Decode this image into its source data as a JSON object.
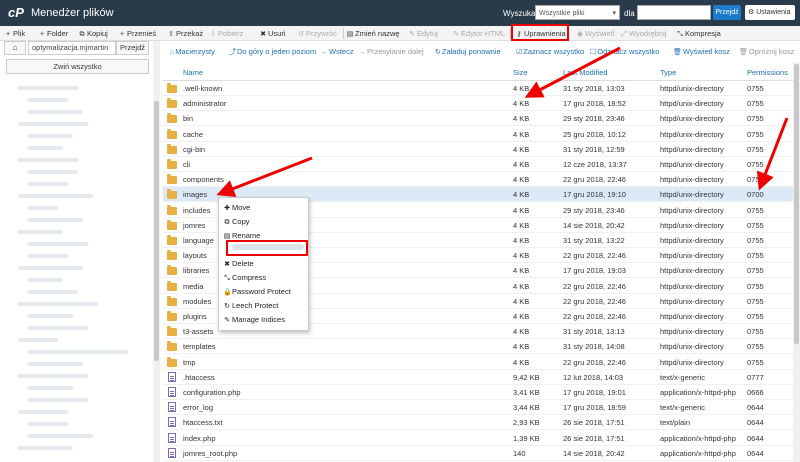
{
  "header": {
    "logo": "cP",
    "title": "Menedżer plików",
    "search_label": "Wyszukaj",
    "search_scope": "Wszystkie pliki",
    "in_label": "dla",
    "search_value": "",
    "go_label": "Przejdź",
    "settings_label": "Ustawienia"
  },
  "toolbar": {
    "file": "Plik",
    "folder": "Folder",
    "copy": "Kopiuj",
    "move": "Przenieś",
    "upload": "Przekaż",
    "download": "Pobierz",
    "delete": "Usuń",
    "restore": "Przywróć",
    "rename": "Zmień nazwę",
    "edit": "Edytuj",
    "html_editor": "Edytor HTML",
    "permissions": "Uprawnienia",
    "view": "Wyświetl",
    "extract": "Wyodrębnij",
    "compress": "Kompresja"
  },
  "left": {
    "path": "optymalizacja.mjmartin",
    "path_go": "Przejdź",
    "collapse_all": "Zwiń wszystko"
  },
  "actions": {
    "home": "Macierzysty",
    "up": "Do góry o jeden poziom",
    "back": "Wstecz",
    "forward": "Przesyłanie dalej",
    "reload": "Załaduj ponownie",
    "select_all": "Zaznacz wszystko",
    "unselect_all": "Odznacz wszystko",
    "view_trash": "Wyświetl kosz",
    "empty_trash": "Opróżnij kosz"
  },
  "table": {
    "columns": {
      "name": "Name",
      "size": "Size",
      "modified": "Last Modified",
      "type": "Type",
      "perms": "Permissions"
    },
    "rows": [
      {
        "kind": "folder",
        "name": ".well-known",
        "size": "4 KB",
        "modified": "31 sty 2018, 13:03",
        "type": "httpd/unix-directory",
        "perms": "0755"
      },
      {
        "kind": "folder",
        "name": "administrator",
        "size": "4 KB",
        "modified": "17 gru 2018, 18:52",
        "type": "httpd/unix-directory",
        "perms": "0755"
      },
      {
        "kind": "folder",
        "name": "bin",
        "size": "4 KB",
        "modified": "29 sty 2018, 23:46",
        "type": "httpd/unix-directory",
        "perms": "0755"
      },
      {
        "kind": "folder",
        "name": "cache",
        "size": "4 KB",
        "modified": "25 gru 2018, 10:12",
        "type": "httpd/unix-directory",
        "perms": "0755"
      },
      {
        "kind": "folder",
        "name": "cgi-bin",
        "size": "4 KB",
        "modified": "31 sty 2018, 12:59",
        "type": "httpd/unix-directory",
        "perms": "0755"
      },
      {
        "kind": "folder",
        "name": "cli",
        "size": "4 KB",
        "modified": "12 cze 2018, 13:37",
        "type": "httpd/unix-directory",
        "perms": "0755"
      },
      {
        "kind": "folder",
        "name": "components",
        "size": "4 KB",
        "modified": "22 gru 2018, 22:46",
        "type": "httpd/unix-directory",
        "perms": "0755"
      },
      {
        "kind": "folder",
        "name": "images",
        "size": "4 KB",
        "modified": "17 gru 2018, 19:10",
        "type": "httpd/unix-directory",
        "perms": "0700",
        "selected": true
      },
      {
        "kind": "folder",
        "name": "includes",
        "size": "4 KB",
        "modified": "29 sty 2018, 23:46",
        "type": "httpd/unix-directory",
        "perms": "0755"
      },
      {
        "kind": "folder",
        "name": "jomres",
        "size": "4 KB",
        "modified": "14 sie 2018, 20:42",
        "type": "httpd/unix-directory",
        "perms": "0755"
      },
      {
        "kind": "folder",
        "name": "language",
        "size": "4 KB",
        "modified": "31 sty 2018, 13:22",
        "type": "httpd/unix-directory",
        "perms": "0755"
      },
      {
        "kind": "folder",
        "name": "layouts",
        "size": "4 KB",
        "modified": "22 gru 2018, 22:46",
        "type": "httpd/unix-directory",
        "perms": "0755"
      },
      {
        "kind": "folder",
        "name": "libraries",
        "size": "4 KB",
        "modified": "17 gru 2018, 19:03",
        "type": "httpd/unix-directory",
        "perms": "0755"
      },
      {
        "kind": "folder",
        "name": "media",
        "size": "4 KB",
        "modified": "22 gru 2018, 22:46",
        "type": "httpd/unix-directory",
        "perms": "0755"
      },
      {
        "kind": "folder",
        "name": "modules",
        "size": "4 KB",
        "modified": "22 gru 2018, 22:46",
        "type": "httpd/unix-directory",
        "perms": "0755"
      },
      {
        "kind": "folder",
        "name": "plugins",
        "size": "4 KB",
        "modified": "22 gru 2018, 22:46",
        "type": "httpd/unix-directory",
        "perms": "0755"
      },
      {
        "kind": "folder",
        "name": "t3-assets",
        "size": "4 KB",
        "modified": "31 sty 2018, 13:13",
        "type": "httpd/unix-directory",
        "perms": "0755"
      },
      {
        "kind": "folder",
        "name": "templates",
        "size": "4 KB",
        "modified": "31 sty 2018, 14:08",
        "type": "httpd/unix-directory",
        "perms": "0755"
      },
      {
        "kind": "folder",
        "name": "tmp",
        "size": "4 KB",
        "modified": "22 gru 2018, 22:46",
        "type": "httpd/unix-directory",
        "perms": "0755"
      },
      {
        "kind": "file",
        "name": ".htaccess",
        "size": "9,42 KB",
        "modified": "12 lut 2018, 14:03",
        "type": "text/x-generic",
        "perms": "0777"
      },
      {
        "kind": "file",
        "name": "configuration.php",
        "size": "3,41 KB",
        "modified": "17 gru 2018, 19:01",
        "type": "application/x-httpd-php",
        "perms": "0666"
      },
      {
        "kind": "file",
        "name": "error_log",
        "size": "3,44 KB",
        "modified": "17 gru 2018, 18:59",
        "type": "text/x-generic",
        "perms": "0644"
      },
      {
        "kind": "file",
        "name": "htaccess.txt",
        "size": "2,93 KB",
        "modified": "26 sie 2018, 17:51",
        "type": "text/plain",
        "perms": "0644"
      },
      {
        "kind": "file",
        "name": "index.php",
        "size": "1,39 KB",
        "modified": "26 sie 2018, 17:51",
        "type": "application/x-httpd-php",
        "perms": "0644"
      },
      {
        "kind": "file",
        "name": "jomres_root.php",
        "size": "140",
        "modified": "14 sie 2018, 20:42",
        "type": "application/x-httpd-php",
        "perms": "0644"
      }
    ]
  },
  "context_menu": {
    "move": "Move",
    "copy": "Copy",
    "rename": "Rename",
    "delete": "Delete",
    "compress": "Compress",
    "password_protect": "Password Protect",
    "leech_protect": "Leech Protect",
    "manage_indices": "Manage Indices"
  },
  "colors": {
    "header_bg": "#293a4a",
    "accent": "#1e6fb8",
    "annotation": "#e00000",
    "selected_row": "#dceaf7"
  }
}
